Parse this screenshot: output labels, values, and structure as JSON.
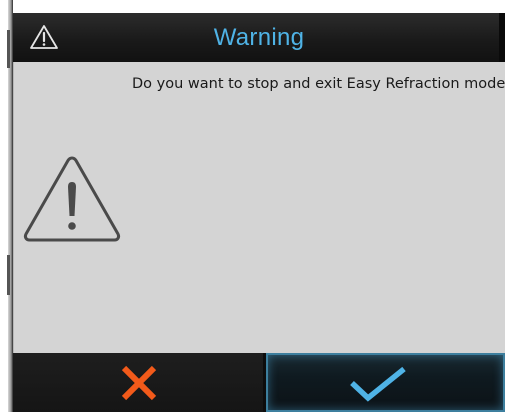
{
  "dialog": {
    "title": "Warning",
    "title_icon": "warning-icon",
    "message": "Do you want to stop and exit Easy Refraction mode?",
    "body_icon": "warning-icon"
  },
  "buttons": {
    "cancel_icon": "close-icon",
    "confirm_icon": "checkmark-icon"
  },
  "colors": {
    "title_text": "#4fb3e6",
    "cancel_accent": "#f25a1a",
    "confirm_accent": "#4fb3e6",
    "body_background": "#d4d4d4",
    "title_background": "#1a1a1a"
  }
}
